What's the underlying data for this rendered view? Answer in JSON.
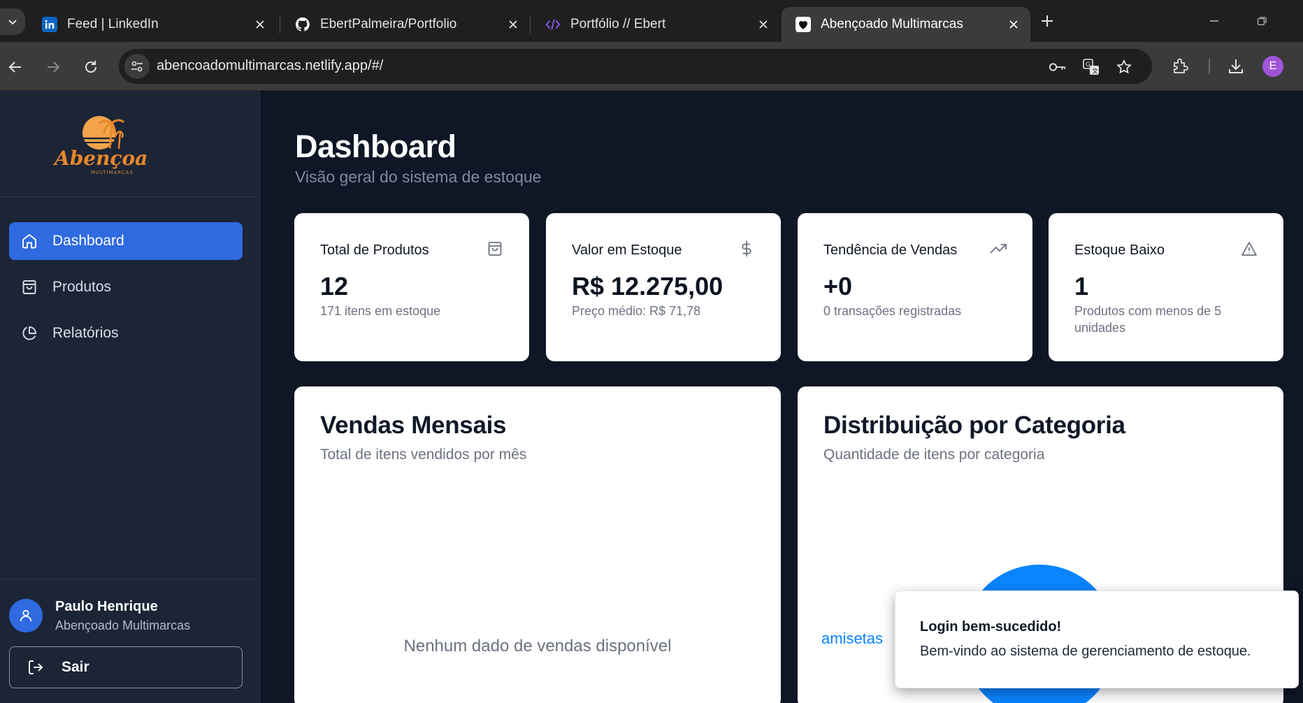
{
  "browser": {
    "tabs": [
      {
        "title": "Feed | LinkedIn",
        "favicon": "linkedin-icon",
        "active": false
      },
      {
        "title": "EbertPalmeira/Portfolio",
        "favicon": "github-icon",
        "active": false
      },
      {
        "title": "Portfólio // Ebert",
        "favicon": "code-icon",
        "active": false
      },
      {
        "title": "Abençoado Multimarcas",
        "favicon": "heart-icon",
        "active": true
      }
    ],
    "url": "abencoadomultimarcas.netlify.app/#/",
    "profile_initial": "E"
  },
  "sidebar": {
    "logo_text": "Abençoado",
    "logo_subtext": "MULTIMARCAS",
    "nav": [
      {
        "label": "Dashboard",
        "icon": "home-icon",
        "active": true
      },
      {
        "label": "Produtos",
        "icon": "shopping-bag-icon",
        "active": false
      },
      {
        "label": "Relatórios",
        "icon": "pie-chart-icon",
        "active": false
      }
    ],
    "user": {
      "name": "Paulo Henrique",
      "company": "Abençoado Multimarcas"
    },
    "logout_label": "Sair"
  },
  "main": {
    "title": "Dashboard",
    "subtitle": "Visão geral do sistema de estoque",
    "stats": [
      {
        "label": "Total de Produtos",
        "value": "12",
        "note": "171 itens em estoque",
        "icon": "shopping-bag-icon"
      },
      {
        "label": "Valor em Estoque",
        "value": "R$ 12.275,00",
        "note": "Preço médio: R$ 71,78",
        "icon": "dollar-icon"
      },
      {
        "label": "Tendência de Vendas",
        "value": "+0",
        "note": "0 transações registradas",
        "icon": "trending-up-icon"
      },
      {
        "label": "Estoque Baixo",
        "value": "1",
        "note": "Produtos com menos de 5 unidades",
        "icon": "alert-triangle-icon"
      }
    ],
    "sales_chart": {
      "title": "Vendas Mensais",
      "subtitle": "Total de itens vendidos por mês",
      "empty_message": "Nenhum dado de vendas disponível"
    },
    "category_chart": {
      "title": "Distribuição por Categoria",
      "subtitle": "Quantidade de itens por categoria",
      "visible_label": "amisetas",
      "color": "#0a84ff"
    }
  },
  "toast": {
    "title": "Login bem-sucedido!",
    "message": "Bem-vindo ao sistema de gerenciamento de estoque."
  },
  "colors": {
    "accent": "#2f6ae0",
    "sidebar_bg": "#1c2536",
    "page_bg": "#0f1626",
    "pie_blue": "#0a84ff",
    "logo_orange": "#e8872a"
  }
}
